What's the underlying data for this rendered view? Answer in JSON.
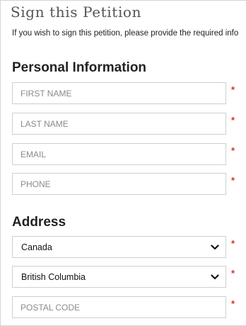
{
  "form": {
    "title": "Sign this Petition",
    "intro": "If you wish to sign this petition, please provide the required info"
  },
  "personal": {
    "heading": "Personal Information",
    "first_name": {
      "placeholder": "FIRST NAME",
      "value": ""
    },
    "last_name": {
      "placeholder": "LAST NAME",
      "value": ""
    },
    "email": {
      "placeholder": "EMAIL",
      "value": ""
    },
    "phone": {
      "placeholder": "PHONE",
      "value": ""
    }
  },
  "address": {
    "heading": "Address",
    "country": {
      "value": "Canada"
    },
    "province": {
      "value": "British Columbia"
    },
    "postal_code": {
      "placeholder": "POSTAL CODE",
      "value": ""
    }
  },
  "required_marker": "*",
  "colors": {
    "required": "#d9302c",
    "border": "#cfcfcf",
    "title": "#555555",
    "heading": "#222222"
  },
  "icons": {
    "dropdown": "chevron-down-icon"
  }
}
